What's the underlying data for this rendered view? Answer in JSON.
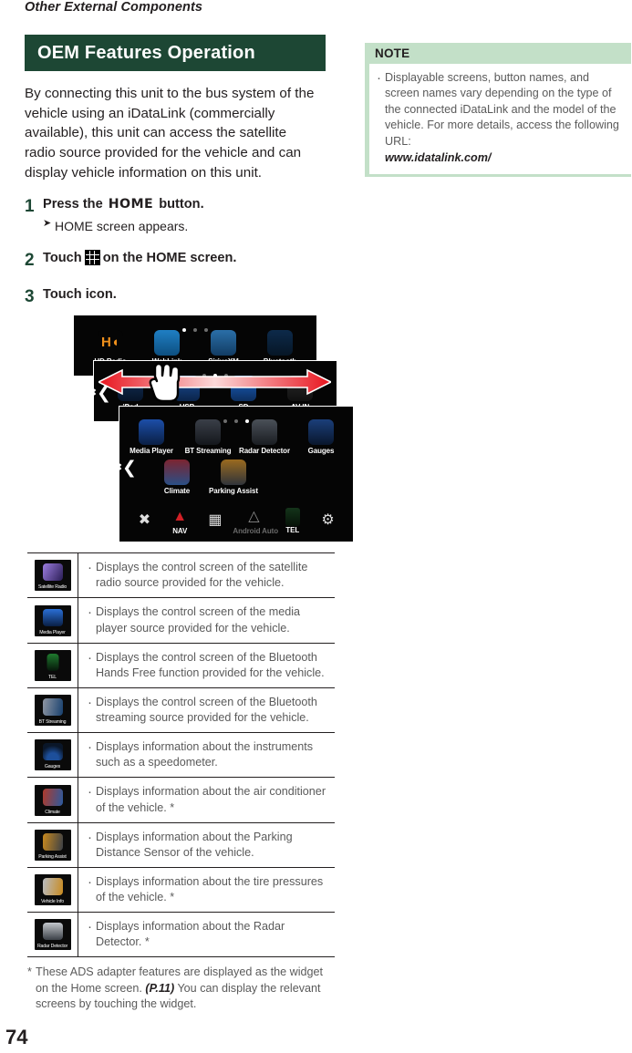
{
  "running_head": "Other External Components",
  "section": {
    "title": "OEM Features Operation",
    "bar_color": "#1d4734",
    "intro": "By connecting this unit to the bus system of the vehicle using an iDataLink (commercially available), this unit can access the satellite radio source provided for the vehicle and can display vehicle information on this unit."
  },
  "steps": [
    {
      "number": "1",
      "text_before": "Press the",
      "key": "HOME",
      "text_after": "button.",
      "substep": "HOME screen appears."
    },
    {
      "number": "2",
      "text_before": "Touch",
      "icon": "grid-icon",
      "text_after": "on the HOME screen."
    },
    {
      "number": "3",
      "text_before": "Touch icon.",
      "icon": "",
      "text_after": ""
    }
  ],
  "illustration": {
    "screen1": {
      "dots": [
        true,
        false,
        false
      ],
      "apps": [
        {
          "label": "HD Radio",
          "glyph": "hd-radio-icon"
        },
        {
          "label": "WebLink",
          "glyph": "weblink-icon"
        },
        {
          "label": "SiriusXM",
          "glyph": "siriusxm-icon"
        },
        {
          "label": "Bluetooth",
          "glyph": "bluetooth-icon"
        }
      ]
    },
    "screen2": {
      "dots": [
        false,
        true,
        false
      ],
      "apps": [
        {
          "label": "iPod",
          "glyph": "ipod-icon"
        },
        {
          "label": "USB",
          "glyph": "usb-icon"
        },
        {
          "label": "SD",
          "glyph": "sd-icon"
        },
        {
          "label": "AV-IN",
          "glyph": "av-in-icon"
        }
      ]
    },
    "screen3": {
      "dots": [
        false,
        false,
        true
      ],
      "apps_row1": [
        {
          "label": "Media Player",
          "glyph": "media-player-icon"
        },
        {
          "label": "BT Streaming",
          "glyph": "bt-streaming-icon"
        },
        {
          "label": "Radar Detector",
          "glyph": "radar-detector-icon"
        },
        {
          "label": "Gauges",
          "glyph": "gauges-icon"
        }
      ],
      "apps_row2": [
        {
          "label": "Climate",
          "glyph": "climate-icon"
        },
        {
          "label": "Parking Assist",
          "glyph": "parking-assist-icon"
        }
      ],
      "bottom_bar": [
        {
          "label": "",
          "glyph": "close-icon"
        },
        {
          "label": "NAV",
          "glyph": "nav-icon"
        },
        {
          "label": "",
          "glyph": "apps-icon"
        },
        {
          "label": "Android Auto",
          "glyph": "android-auto-icon",
          "dim": true
        },
        {
          "label": "TEL",
          "glyph": "tel-icon"
        },
        {
          "label": "",
          "glyph": "gear-icon"
        }
      ]
    },
    "swipe_arrow": "double-arrow-icon",
    "hand": "hand-pointer-icon"
  },
  "feature_table": {
    "rows": [
      {
        "icon_label": "Satellite Radio",
        "icon_name": "satellite-radio-icon",
        "description": "Displays the control screen of the satellite radio source provided for the vehicle."
      },
      {
        "icon_label": "Media Player",
        "icon_name": "media-player-icon",
        "description": "Displays the control screen of the media player source provided for the vehicle."
      },
      {
        "icon_label": "TEL",
        "icon_name": "tel-icon",
        "description": "Displays the control screen of the Bluetooth Hands Free function provided for the vehicle."
      },
      {
        "icon_label": "BT Streaming",
        "icon_name": "bt-streaming-icon",
        "description": "Displays the control screen of the Bluetooth streaming source provided for the vehicle."
      },
      {
        "icon_label": "Gauges",
        "icon_name": "gauges-icon",
        "description": "Displays information about the instruments such as a speedometer."
      },
      {
        "icon_label": "Climate",
        "icon_name": "climate-icon",
        "description": "Displays information about the air conditioner of the vehicle. *"
      },
      {
        "icon_label": "Parking Assist",
        "icon_name": "parking-assist-icon",
        "description": "Displays information about the Parking Distance Sensor of the vehicle."
      },
      {
        "icon_label": "Vehicle Info",
        "icon_name": "vehicle-info-icon",
        "description": "Displays information about the tire pressures of the vehicle. *"
      },
      {
        "icon_label": "Radar Detector",
        "icon_name": "radar-detector-icon",
        "description": "Displays information about the Radar Detector. *"
      }
    ]
  },
  "footnote": {
    "star": "*",
    "part1": "These ADS adapter features are displayed as the widget on the Home screen.",
    "reference": "(P.11)",
    "part2": "You can display the relevant screens by touching the widget."
  },
  "note": {
    "heading": "NOTE",
    "header_color": "#c3e0c8",
    "body": "Displayable screens, button names, and screen names vary depending on the type of the connected iDataLink and the model of the vehicle. For more details, access the following URL:",
    "url": "www.idatalink.com/"
  },
  "page_number": "74"
}
